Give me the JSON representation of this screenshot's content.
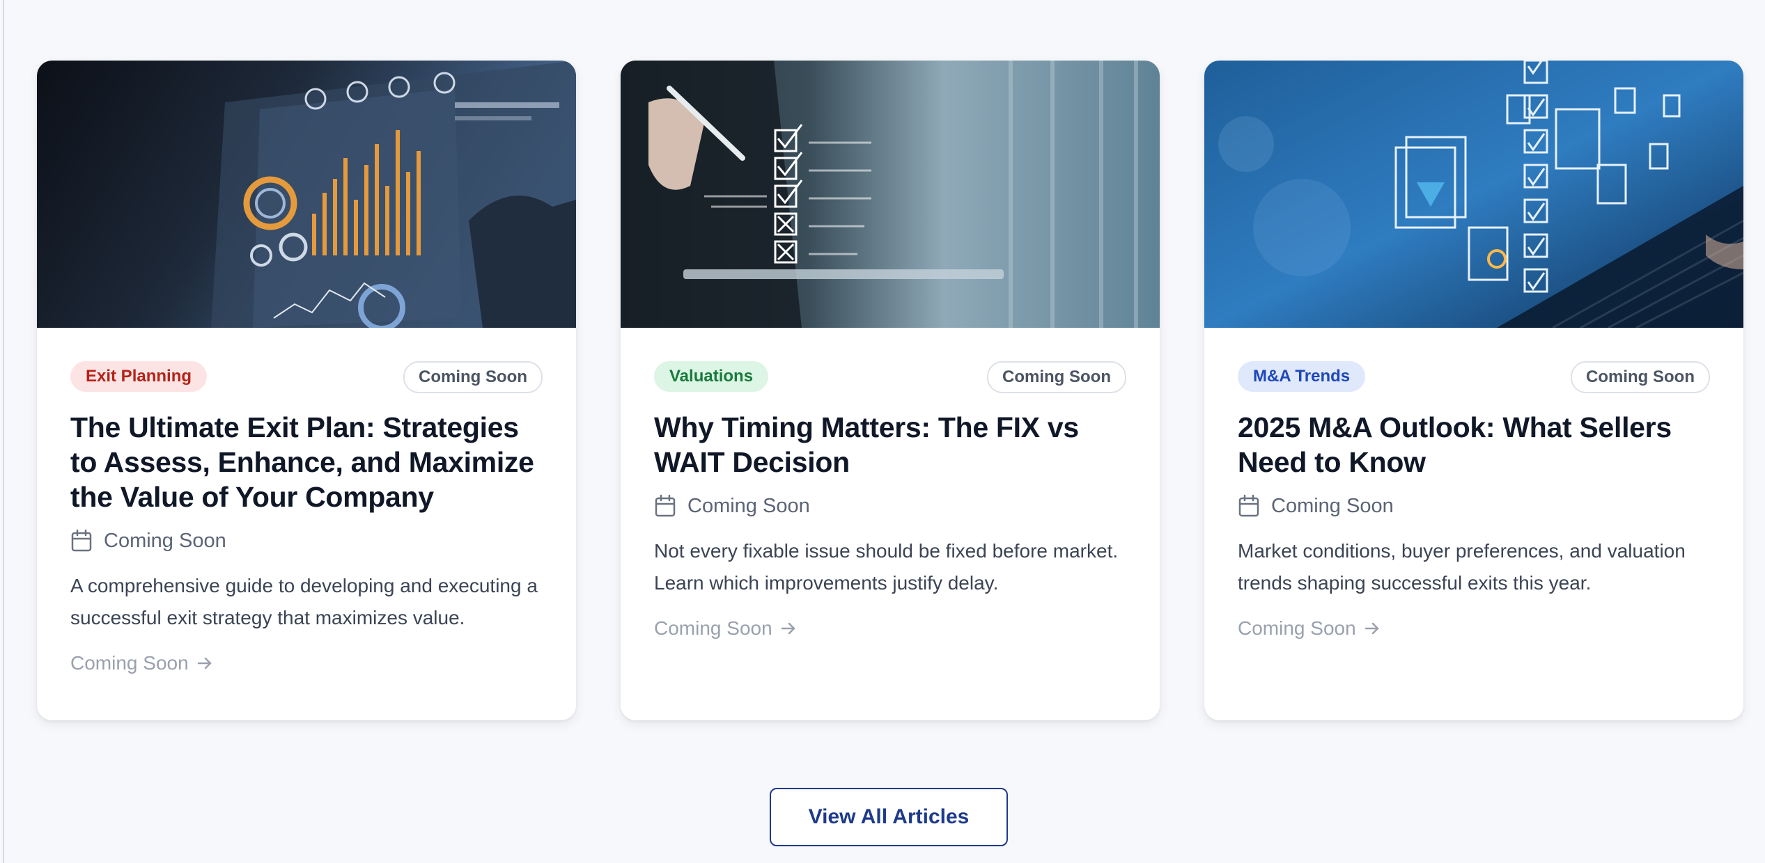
{
  "articles": [
    {
      "category": "Exit Planning",
      "status": "Coming Soon",
      "title": "The Ultimate Exit Plan: Strategies to Assess, Enhance, and Maximize the Value of Your Company",
      "date": "Coming Soon",
      "excerpt": "A comprehensive guide to developing and executing a successful exit strategy that maximizes value.",
      "link": "Coming Soon",
      "image": "financial-dashboard-hologram"
    },
    {
      "category": "Valuations",
      "status": "Coming Soon",
      "title": "Why Timing Matters: The FIX vs WAIT Decision",
      "date": "Coming Soon",
      "excerpt": "Not every fixable issue should be fixed before market. Learn which improvements justify delay.",
      "link": "Coming Soon",
      "image": "checklist-tablet-warehouse"
    },
    {
      "category": "M&A Trends",
      "status": "Coming Soon",
      "title": "2025 M&A Outlook: What Sellers Need to Know",
      "date": "Coming Soon",
      "excerpt": "Market conditions, buyer preferences, and valuation trends shaping successful exits this year.",
      "link": "Coming Soon",
      "image": "laptop-document-icons"
    }
  ],
  "view_all_label": "View All Articles",
  "colors": {
    "exit_planning": "#b42318",
    "valuations": "#1a7a3c",
    "ma_trends": "#1e47b8",
    "button_accent": "#1e3a8a"
  }
}
